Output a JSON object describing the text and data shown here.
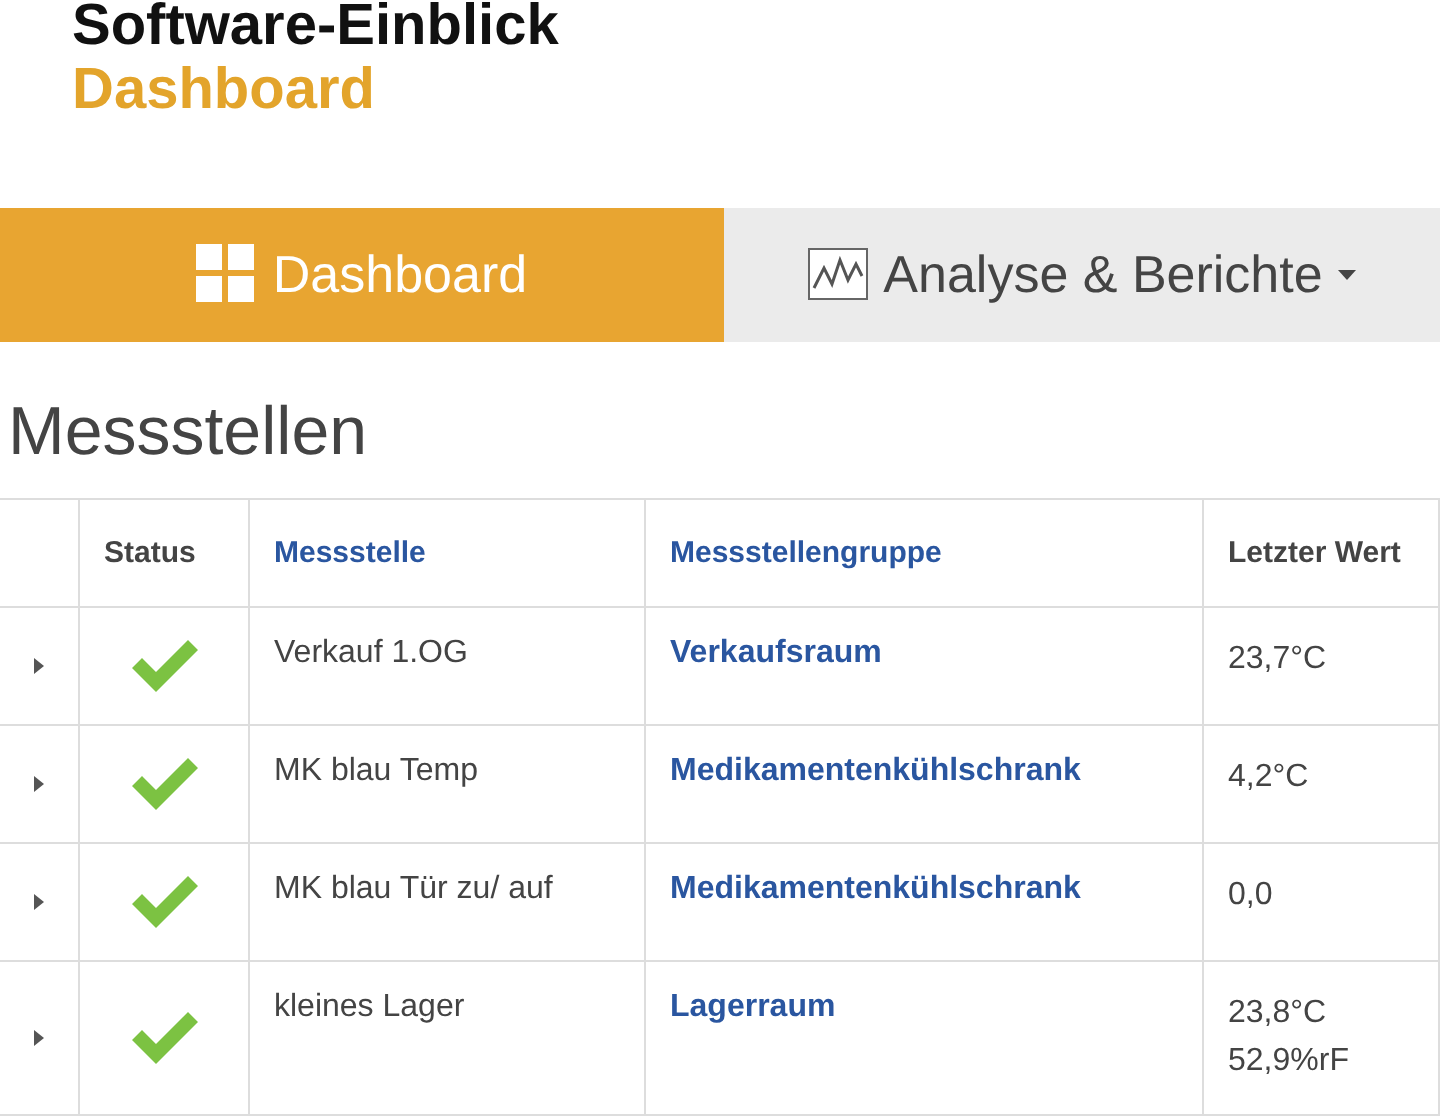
{
  "header": {
    "title": "Software-Einblick",
    "subtitle": "Dashboard"
  },
  "tabs": [
    {
      "label": "Dashboard",
      "kind": "grid",
      "selected": true,
      "dropdown": false
    },
    {
      "label": "Analyse & Berichte",
      "kind": "chart",
      "selected": false,
      "dropdown": true
    }
  ],
  "section_title": "Messstellen",
  "table": {
    "columns": [
      {
        "label": "Status",
        "kind": "plain"
      },
      {
        "label": "Messstelle",
        "kind": "link"
      },
      {
        "label": "Messstellengruppe",
        "kind": "link"
      },
      {
        "label": "Letzter Wert",
        "kind": "plain"
      }
    ],
    "rows": [
      {
        "kind": "ok",
        "name": "Verkauf 1.OG",
        "group": "Verkaufsraum",
        "values": [
          "23,7°C"
        ]
      },
      {
        "kind": "ok",
        "name": "MK blau Temp",
        "group": "Medikamentenkühlschrank",
        "values": [
          "4,2°C"
        ]
      },
      {
        "kind": "ok",
        "name": "MK blau Tür zu/ auf",
        "group": "Medikamentenkühlschrank",
        "values": [
          "0,0"
        ]
      },
      {
        "kind": "ok",
        "name": "kleines Lager",
        "group": "Lagerraum",
        "values": [
          "23,8°C",
          "52,9%rF"
        ]
      }
    ]
  }
}
